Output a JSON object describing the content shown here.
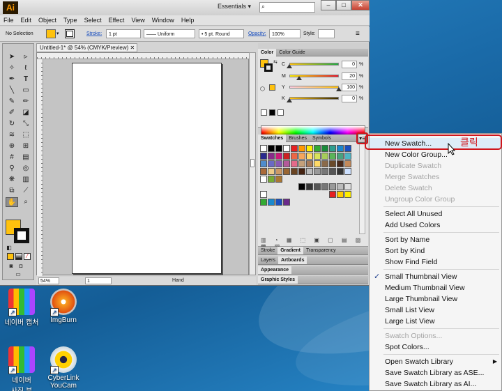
{
  "app": {
    "logo": "Ai",
    "workspace": "Essentials",
    "menu": [
      "File",
      "Edit",
      "Object",
      "Type",
      "Select",
      "Effect",
      "View",
      "Window",
      "Help"
    ]
  },
  "control_bar": {
    "selection": "No Selection",
    "stroke_label": "Stroke:",
    "stroke_weight": "1 pt",
    "stroke_style": "Uniform",
    "brush": "5 pt. Round",
    "opacity_label": "Opacity:",
    "opacity": "100%",
    "style_label": "Style:"
  },
  "document": {
    "tab_title": "Untitled-1* @ 54% (CMYK/Preview)",
    "zoom": "54%",
    "artboard_num": "1",
    "tool_name": "Hand"
  },
  "color_panel": {
    "tabs": [
      "Color",
      "Color Guide"
    ],
    "channels": [
      {
        "label": "C",
        "value": "0",
        "fraction": 0.0
      },
      {
        "label": "M",
        "value": "20",
        "fraction": 0.2
      },
      {
        "label": "Y",
        "value": "100",
        "fraction": 1.0
      },
      {
        "label": "K",
        "value": "0",
        "fraction": 0.0
      }
    ],
    "pct": "%",
    "fill_color": "#ffc20e"
  },
  "swatches_panel": {
    "tabs": [
      "Swatches",
      "Brushes",
      "Symbols"
    ]
  },
  "docked_panels": [
    {
      "tabs": [
        "Stroke",
        "Gradient",
        "Transparency"
      ]
    },
    {
      "tabs": [
        "Layers",
        "Artboards"
      ]
    },
    {
      "tabs": [
        "Appearance"
      ]
    },
    {
      "tabs": [
        "Graphic Styles"
      ]
    }
  ],
  "menu": {
    "items": [
      {
        "label": "New Swatch...",
        "disabled": false,
        "highlight": true
      },
      {
        "label": "New Color Group...",
        "disabled": false
      },
      {
        "label": "Duplicate Swatch",
        "disabled": true
      },
      {
        "label": "Merge Swatches",
        "disabled": true
      },
      {
        "label": "Delete Swatch",
        "disabled": true
      },
      {
        "label": "Ungroup Color Group",
        "disabled": true
      },
      {
        "label": "Select All Unused",
        "disabled": false
      },
      {
        "label": "Add Used Colors",
        "disabled": false
      },
      {
        "label": "Sort by Name",
        "disabled": false
      },
      {
        "label": "Sort by Kind",
        "disabled": false
      },
      {
        "label": "Show Find Field",
        "disabled": false
      },
      {
        "label": "Small Thumbnail View",
        "disabled": false,
        "checked": true
      },
      {
        "label": "Medium Thumbnail View",
        "disabled": false
      },
      {
        "label": "Large Thumbnail View",
        "disabled": false
      },
      {
        "label": "Small List View",
        "disabled": false
      },
      {
        "label": "Large List View",
        "disabled": false
      },
      {
        "label": "Swatch Options...",
        "disabled": true
      },
      {
        "label": "Spot Colors...",
        "disabled": false
      },
      {
        "label": "Open Swatch Library",
        "disabled": false,
        "submenu": true
      },
      {
        "label": "Save Swatch Library as ASE...",
        "disabled": false
      },
      {
        "label": "Save Swatch Library as AI...",
        "disabled": false
      }
    ],
    "annotation": "클릭",
    "accent_color": "#d0161c"
  },
  "desktop_icons": [
    {
      "label": "네이버 캡처"
    },
    {
      "label": "ImgBurn"
    },
    {
      "label": "네이버"
    },
    {
      "label": "CyberLink"
    },
    {
      "label": "사진 뷰"
    },
    {
      "label": "YouCam"
    }
  ]
}
